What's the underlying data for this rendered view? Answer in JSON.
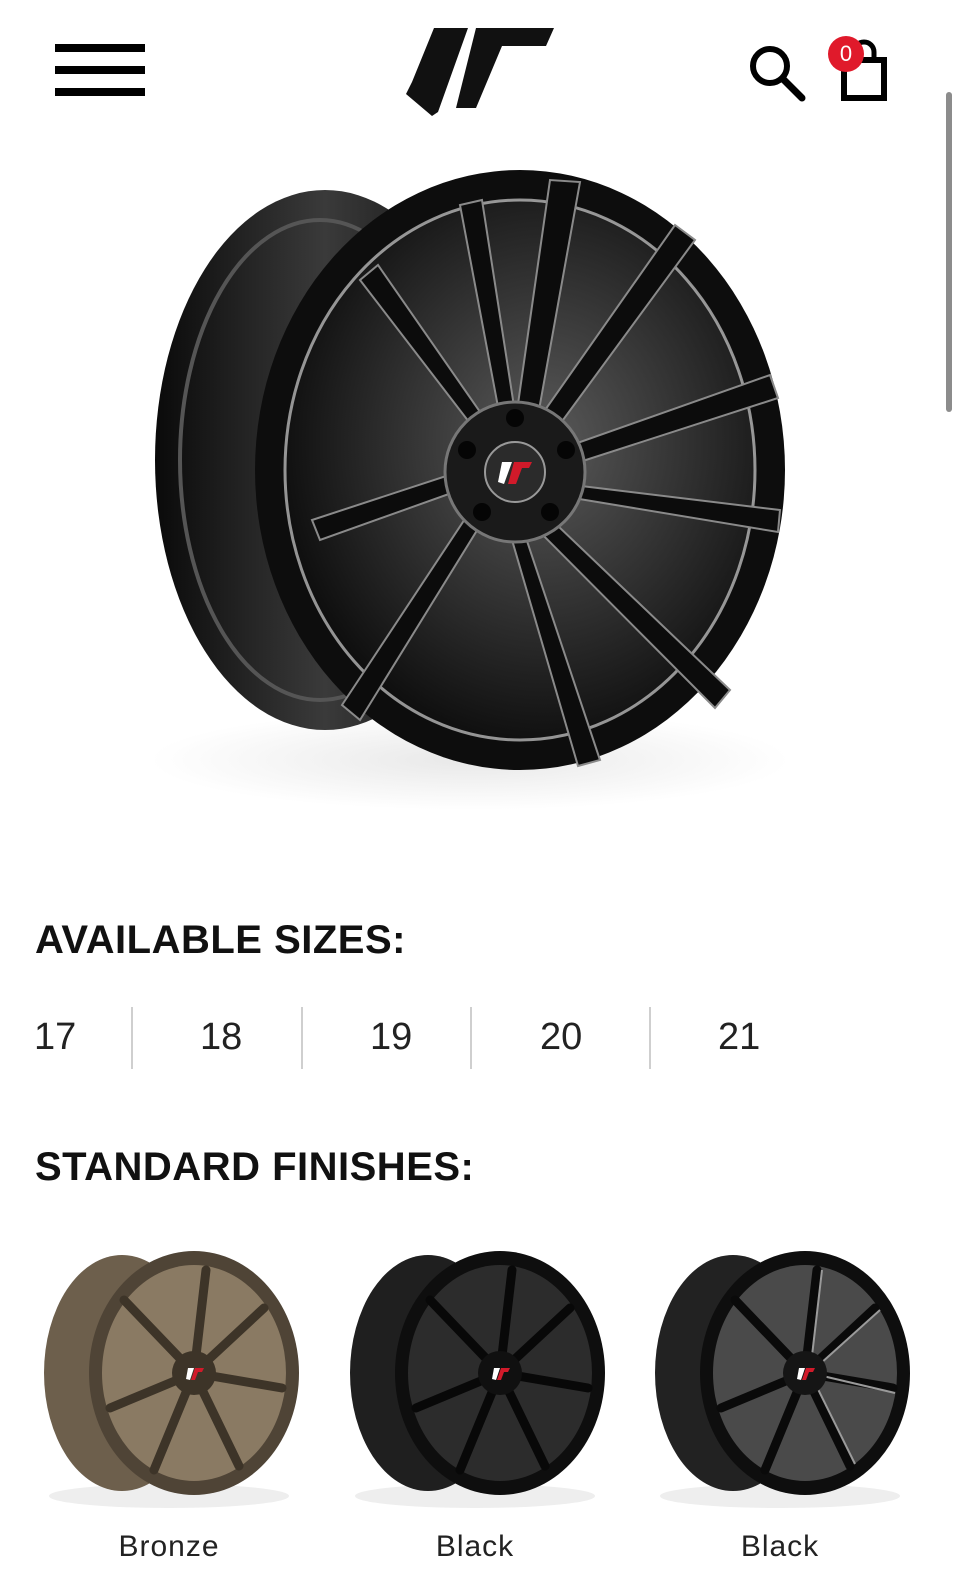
{
  "header": {
    "menu_icon": "hamburger-menu-icon",
    "logo_icon": "jr-wheels-logo",
    "search_icon": "search-icon",
    "cart_icon": "shopping-bag-icon",
    "cart_count": "0",
    "badge_color": "#e01a2b"
  },
  "product": {
    "hero_image": "wheel-gloss-black-machined-face"
  },
  "sizes": {
    "title": "AVAILABLE SIZES:",
    "items": [
      "17",
      "18",
      "19",
      "20",
      "21"
    ]
  },
  "finishes": {
    "title": "STANDARD FINISHES:",
    "items": [
      {
        "label": "Bronze",
        "color": "#7a6a55"
      },
      {
        "label": "Black",
        "color": "#1a1a1a"
      },
      {
        "label": "Black",
        "color": "#262626"
      }
    ]
  }
}
